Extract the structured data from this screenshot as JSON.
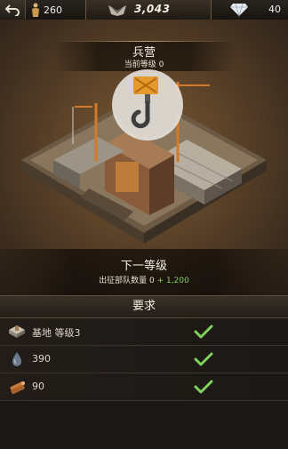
{
  "topbar": {
    "population": "260",
    "power": "3,043",
    "diamonds": "40"
  },
  "building": {
    "name": "兵营",
    "current_level": "当前等级 0"
  },
  "next_level": {
    "title": "下一等级",
    "stat_label": "出征部队数量",
    "stat_value": "0",
    "stat_increase": "+ 1,200"
  },
  "requirements": {
    "header": "要求",
    "items": [
      {
        "label": "基地 等级3",
        "icon": "base-icon",
        "met": true
      },
      {
        "label": "390",
        "icon": "oil-drop-icon",
        "met": true
      },
      {
        "label": "90",
        "icon": "wood-icon",
        "met": true
      }
    ]
  },
  "colors": {
    "accent_gold": "#d9b36a",
    "check_green": "#7fd35c",
    "increase_green": "#7fd35c"
  }
}
